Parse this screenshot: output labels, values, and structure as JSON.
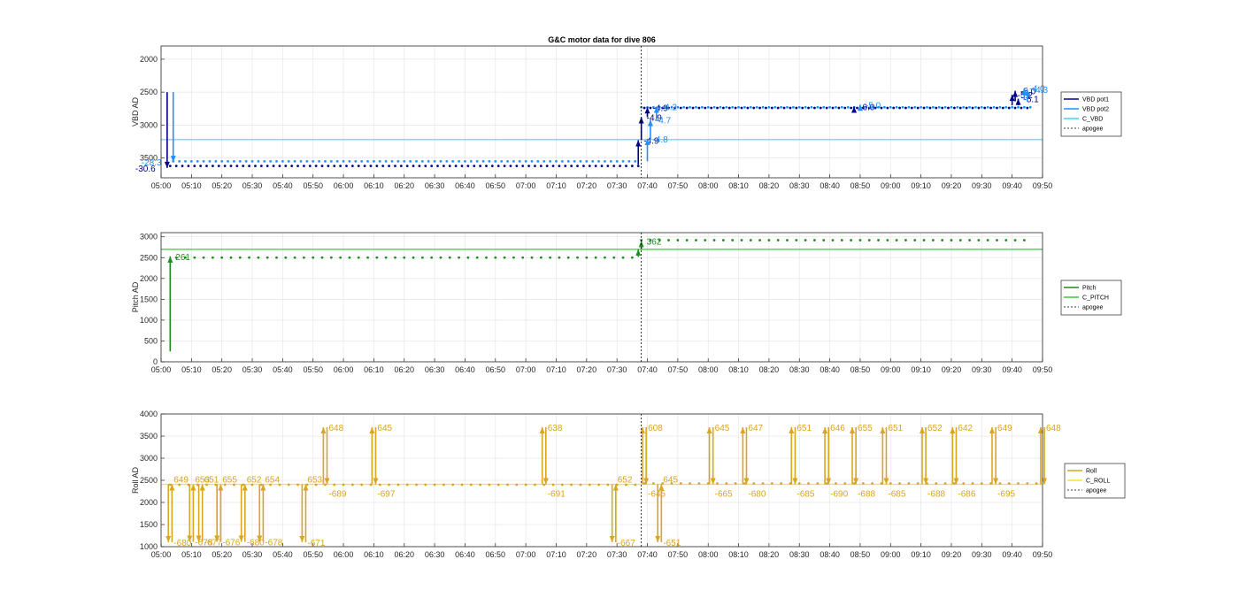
{
  "figure_title": "G&C motor data for dive 806",
  "x_ticks": [
    "05:00",
    "05:10",
    "05:20",
    "05:30",
    "05:40",
    "05:50",
    "06:00",
    "06:10",
    "06:20",
    "06:30",
    "06:40",
    "06:50",
    "07:00",
    "07:10",
    "07:20",
    "07:30",
    "07:40",
    "07:50",
    "08:00",
    "08:10",
    "08:20",
    "08:30",
    "08:40",
    "08:50",
    "09:00",
    "09:10",
    "09:20",
    "09:30",
    "09:40",
    "09:50"
  ],
  "chart_data": [
    {
      "type": "scatter",
      "ylabel": "VBD AD",
      "xlim": [
        300,
        590
      ],
      "ylim": [
        3800,
        1800
      ],
      "y_reversed": true,
      "y_ticks": [
        2000,
        2500,
        3000,
        3500
      ],
      "apogee_x": 458,
      "colors": {
        "vbd_pot1": "#00008B",
        "vbd_pot2": "#1E90FF",
        "c_vbd": "#40D8E8"
      },
      "legend": [
        "VBD pot1",
        "VBD pot2",
        "C_VBD",
        "apogee"
      ],
      "legend_position": "outside-right",
      "c_vbd_value": 3220,
      "series": [
        {
          "name": "VBD pot1",
          "x_start": 303,
          "x_end": 586,
          "y_dive": 3620,
          "y_climb": 2740,
          "step_x": 2
        },
        {
          "name": "VBD pot2",
          "x_start": 304,
          "x_end": 586,
          "y_dive": 3550,
          "y_climb": 2730,
          "step_x": 2
        }
      ],
      "arrows": [
        {
          "x": 302,
          "y0": 2500,
          "y1": 3650,
          "color": "#00008B",
          "label": "-30.6"
        },
        {
          "x": 304,
          "y0": 2500,
          "y1": 3560,
          "color": "#1E90FF",
          "label": "-28.3"
        },
        {
          "x": 457,
          "y0": 3600,
          "y1": 3230,
          "color": "#00008B",
          "label": "-4.9"
        },
        {
          "x": 458,
          "y0": 3230,
          "y1": 2880,
          "color": "#00008B",
          "label": "-4.9"
        },
        {
          "x": 460,
          "y0": 2880,
          "y1": 2730,
          "color": "#00008B",
          "label": "-4.9"
        },
        {
          "x": 460,
          "y0": 3550,
          "y1": 3210,
          "color": "#1E90FF",
          "label": "-4.8"
        },
        {
          "x": 461,
          "y0": 3210,
          "y1": 2920,
          "color": "#1E90FF",
          "label": "-4.7"
        },
        {
          "x": 463,
          "y0": 2920,
          "y1": 2720,
          "color": "#1E90FF",
          "label": "-4.2"
        },
        {
          "x": 528,
          "y0": 2760,
          "y1": 2720,
          "color": "#00008B",
          "label": "-6.0"
        },
        {
          "x": 530,
          "y0": 2740,
          "y1": 2690,
          "color": "#1E90FF",
          "label": "-5.0"
        },
        {
          "x": 580,
          "y0": 2700,
          "y1": 2540,
          "color": "#00008B",
          "label": "-5.2"
        },
        {
          "x": 581,
          "y0": 2640,
          "y1": 2480,
          "color": "#00008B",
          "label": "-5.0"
        },
        {
          "x": 582,
          "y0": 2700,
          "y1": 2600,
          "color": "#00008B",
          "label": "-5.1"
        },
        {
          "x": 584,
          "y0": 2620,
          "y1": 2440,
          "color": "#1E90FF",
          "label": "-4.0"
        },
        {
          "x": 585,
          "y0": 2640,
          "y1": 2460,
          "color": "#1E90FF",
          "label": "-4.3"
        }
      ]
    },
    {
      "type": "scatter",
      "ylabel": "Pitch AD",
      "xlim": [
        300,
        590
      ],
      "ylim": [
        0,
        3100
      ],
      "y_ticks": [
        0,
        500,
        1000,
        1500,
        2000,
        2500,
        3000
      ],
      "apogee_x": 458,
      "colors": {
        "pitch": "#1E8C1E",
        "c_pitch": "#3CC83C"
      },
      "legend": [
        "Pitch",
        "C_PITCH",
        "apogee"
      ],
      "legend_position": "outside-right",
      "c_pitch_value": 2700,
      "series": [
        {
          "name": "Pitch",
          "x_start": 305,
          "x_end": 586,
          "y_dive": 2500,
          "y_climb": 2920,
          "step_x": 3
        }
      ],
      "arrows": [
        {
          "x": 303,
          "y0": 250,
          "y1": 2530,
          "color": "#1E8C1E",
          "label": "261"
        },
        {
          "x": 457,
          "y0": 2520,
          "y1": 2700,
          "color": "#1E8C1E",
          "label": ""
        },
        {
          "x": 458,
          "y0": 2700,
          "y1": 2900,
          "color": "#1E8C1E",
          "label": "362"
        }
      ]
    },
    {
      "type": "scatter",
      "ylabel": "Roll AD",
      "xlim": [
        300,
        590
      ],
      "ylim": [
        1000,
        4000
      ],
      "y_ticks": [
        1000,
        1500,
        2000,
        2500,
        3000,
        3500,
        4000
      ],
      "apogee_x": 458,
      "colors": {
        "roll": "#DAA520",
        "c_roll": "#F2E33C"
      },
      "legend": [
        "Roll",
        "C_ROLL",
        "apogee"
      ],
      "legend_position": "outside-right",
      "c_roll_value": 2410,
      "series": [
        {
          "name": "Roll",
          "x_start": 303,
          "x_end": 589,
          "y_dive": 2400,
          "y_climb": 2430,
          "step_x": 3
        }
      ],
      "pulses": [
        {
          "x": 303,
          "y_peak": 1100,
          "up_label": "649",
          "down_label": "-680"
        },
        {
          "x": 310,
          "y_peak": 1110,
          "up_label": "653",
          "down_label": "-678"
        },
        {
          "x": 313,
          "y_peak": 1110,
          "up_label": "651",
          "down_label": "-677"
        },
        {
          "x": 319,
          "y_peak": 1110,
          "up_label": "655",
          "down_label": "-676"
        },
        {
          "x": 327,
          "y_peak": 1110,
          "up_label": "652",
          "down_label": "-680"
        },
        {
          "x": 333,
          "y_peak": 1110,
          "up_label": "654",
          "down_label": "-678"
        },
        {
          "x": 347,
          "y_peak": 1100,
          "up_label": "653",
          "down_label": "-671"
        },
        {
          "x": 354,
          "y_peak": 3700,
          "up_label": "648",
          "down_label": "-689"
        },
        {
          "x": 370,
          "y_peak": 3700,
          "up_label": "645",
          "down_label": "-697"
        },
        {
          "x": 426,
          "y_peak": 3700,
          "up_label": "638",
          "down_label": "-691"
        },
        {
          "x": 449,
          "y_peak": 1100,
          "up_label": "652",
          "down_label": "-667"
        },
        {
          "x": 459,
          "y_peak": 3700,
          "up_label": "608",
          "down_label": "-645"
        },
        {
          "x": 464,
          "y_peak": 1100,
          "up_label": "645",
          "down_label": "-651"
        },
        {
          "x": 481,
          "y_peak": 3700,
          "up_label": "645",
          "down_label": "-665"
        },
        {
          "x": 492,
          "y_peak": 3700,
          "up_label": "647",
          "down_label": "-680"
        },
        {
          "x": 508,
          "y_peak": 3700,
          "up_label": "651",
          "down_label": "-685"
        },
        {
          "x": 519,
          "y_peak": 3700,
          "up_label": "646",
          "down_label": "-690"
        },
        {
          "x": 528,
          "y_peak": 3700,
          "up_label": "655",
          "down_label": "-688"
        },
        {
          "x": 538,
          "y_peak": 3700,
          "up_label": "651",
          "down_label": "-685"
        },
        {
          "x": 551,
          "y_peak": 3700,
          "up_label": "652",
          "down_label": "-688"
        },
        {
          "x": 561,
          "y_peak": 3700,
          "up_label": "642",
          "down_label": "-686"
        },
        {
          "x": 574,
          "y_peak": 3700,
          "up_label": "649",
          "down_label": "-695"
        },
        {
          "x": 590,
          "y_peak": 3700,
          "up_label": "648",
          "down_label": ""
        }
      ]
    }
  ]
}
